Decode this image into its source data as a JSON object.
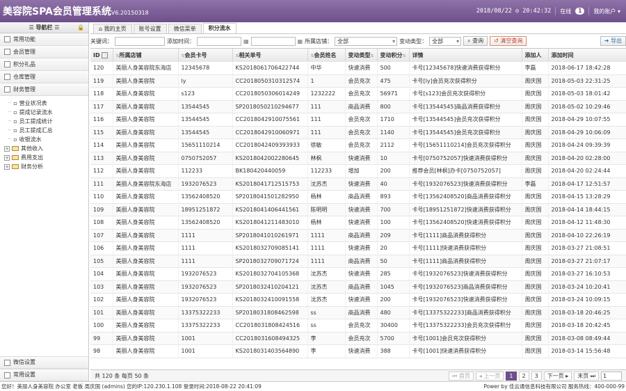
{
  "app": {
    "title": "美容院SPA会员管理系统",
    "version": "V6.20150318"
  },
  "topbar": {
    "datetime": "2018/08/22 ◎ 20:42:32",
    "online_label": "在线",
    "online_count": "1",
    "account_label": "我的账户"
  },
  "sidebar": {
    "header": "导航栏",
    "sections": [
      "常用功能",
      "会员管理",
      "积分礼品",
      "仓库管理",
      "财务管理"
    ],
    "finance_items": [
      "营业状况表",
      "提成记录流水",
      "员工提成统计",
      "员工提成汇总",
      "收银流水"
    ],
    "finance_groups": [
      "其他收入",
      "费用支出",
      "财务分析"
    ],
    "bottom_sections": [
      "微信设置",
      "常用设置"
    ]
  },
  "tabs": [
    "我的主页",
    "账号设置",
    "微信菜单",
    "积分流水"
  ],
  "filter": {
    "keyword_label": "关键词：",
    "time_label": "添加时间：",
    "store_label": "所属店铺：",
    "store_value": "全部",
    "change_type_label": "变动类型：",
    "change_type_value": "全部",
    "search_btn": "查询",
    "clear_btn": "清空查询",
    "export_btn": "导出"
  },
  "table": {
    "columns": [
      "ID",
      "所属店铺",
      "会员卡号",
      "相关单号",
      "会员姓名",
      "变动类型",
      "变动积分",
      "详情",
      "添加人",
      "添加时间"
    ],
    "rows": [
      [
        "120",
        "美丽人身美容院东海店",
        "12345678",
        "KS2018061706422744",
        "中华",
        "快速消费",
        "500",
        "卡号[12345678]快速消费获得积分",
        "李磊",
        "2018-06-17 18:42:28"
      ],
      [
        "119",
        "美丽人身美容院",
        "ly",
        "CC2018050310312574",
        "1",
        "会员充次",
        "475",
        "卡号[ly]会员充次获得积分",
        "周庆国",
        "2018-05-03 22:31:25"
      ],
      [
        "118",
        "美丽人身美容院",
        "s123",
        "CC2018050306014249",
        "1232222",
        "会员充次",
        "56971",
        "卡号[s123]会员充次获得积分",
        "周庆国",
        "2018-05-03 18:01:42"
      ],
      [
        "117",
        "美丽人身美容院",
        "13544545",
        "SP2018050210294677",
        "111",
        "商品消费",
        "800",
        "卡号[13544545]商品消费获得积分",
        "周庆国",
        "2018-05-02 10:29:46"
      ],
      [
        "116",
        "美丽人身美容院",
        "13544545",
        "CC2018042910075561",
        "111",
        "会员充次",
        "1710",
        "卡号[13544545]会员充次获得积分",
        "周庆国",
        "2018-04-29 10:07:55"
      ],
      [
        "115",
        "美丽人身美容院",
        "13544545",
        "CC2018042910060971",
        "111",
        "会员充次",
        "1140",
        "卡号[13544545]会员充次获得积分",
        "周庆国",
        "2018-04-29 10:06:09"
      ],
      [
        "114",
        "美丽人身美容院",
        "15651110214",
        "CC2018042409393933",
        "徐敏",
        "会员充次",
        "2112",
        "卡号[15651110214]会员充次获得积分",
        "周庆国",
        "2018-04-24 09:39:39"
      ],
      [
        "113",
        "美丽人身美容院",
        "0750752057",
        "KS2018042002280645",
        "林枫",
        "快速消费",
        "10",
        "卡号[0750752057]快速消费获得积分",
        "周庆国",
        "2018-04-20 02:28:00"
      ],
      [
        "112",
        "美丽人身美容院",
        "112233",
        "BK180420440059",
        "112233",
        "增加",
        "200",
        "推荐会员[林枫]办卡[0750752057]",
        "周庆国",
        "2018-04-20 02:24:44"
      ],
      [
        "111",
        "美丽人身美容院东海店",
        "1932076523",
        "KS2018041712515753",
        "沈苏杰",
        "快速消费",
        "40",
        "卡号[1932076523]快速消费获得积分",
        "李磊",
        "2018-04-17 12:51:57"
      ],
      [
        "110",
        "美丽人身美容院",
        "13562408520",
        "SP2018041501282950",
        "杨林",
        "商品消费",
        "893",
        "卡号[13562408520]商品消费获得积分",
        "周庆国",
        "2018-04-15 13:28:29"
      ],
      [
        "109",
        "美丽人身美容院",
        "18951251872",
        "KS2018041406441561",
        "陈明明",
        "快速消费",
        "700",
        "卡号[18951251872]快速消费获得积分",
        "周庆国",
        "2018-04-14 18:44:15"
      ],
      [
        "108",
        "美丽人身美容院",
        "13562408520",
        "KS2018041211483010",
        "杨林",
        "快速消费",
        "100",
        "卡号[13562408520]快速消费获得积分",
        "周庆国",
        "2018-04-12 11:48:30"
      ],
      [
        "107",
        "美丽人身美容院",
        "1111",
        "SP2018041010261971",
        "1111",
        "商品消费",
        "209",
        "卡号[1111]商品消费获得积分",
        "周庆国",
        "2018-04-10 22:26:19"
      ],
      [
        "106",
        "美丽人身美容院",
        "1111",
        "KS2018032709085141",
        "1111",
        "快速消费",
        "20",
        "卡号[1111]快速消费获得积分",
        "周庆国",
        "2018-03-27 21:08:51"
      ],
      [
        "105",
        "美丽人身美容院",
        "1111",
        "SP2018032709071724",
        "1111",
        "商品消费",
        "50",
        "卡号[1111]商品消费获得积分",
        "周庆国",
        "2018-03-27 21:07:17"
      ],
      [
        "104",
        "美丽人身美容院",
        "1932076523",
        "KS2018032704105368",
        "沈苏杰",
        "快速消费",
        "285",
        "卡号[1932076523]快速消费获得积分",
        "周庆国",
        "2018-03-27 16:10:53"
      ],
      [
        "103",
        "美丽人身美容院",
        "1932076523",
        "SP2018032410204121",
        "沈苏杰",
        "商品消费",
        "1045",
        "卡号[1932076523]商品消费获得积分",
        "周庆国",
        "2018-03-24 10:20:41"
      ],
      [
        "102",
        "美丽人身美容院",
        "1932076523",
        "KS2018032410091558",
        "沈苏杰",
        "快速消费",
        "200",
        "卡号[1932076523]快速消费获得积分",
        "周庆国",
        "2018-03-24 10:09:15"
      ],
      [
        "101",
        "美丽人身美容院",
        "13375322233",
        "SP2018031808462598",
        "ss",
        "商品消费",
        "480",
        "卡号[13375322233]商品消费获得积分",
        "周庆国",
        "2018-03-18 20:46:25"
      ],
      [
        "100",
        "美丽人身美容院",
        "13375322233",
        "CC2018031808424516",
        "ss",
        "会员充次",
        "30400",
        "卡号[13375322233]会员充次获得积分",
        "周庆国",
        "2018-03-18 20:42:45"
      ],
      [
        "99",
        "美丽人身美容院",
        "1001",
        "CC2018031608494325",
        "李",
        "会员充次",
        "5700",
        "卡号[1001]会员充次获得积分",
        "周庆国",
        "2018-03-08 08:49:44"
      ],
      [
        "98",
        "美丽人身美容院",
        "1001",
        "KS2018031403564890",
        "李",
        "快速消费",
        "388",
        "卡号[1001]快速消费获得积分",
        "周庆国",
        "2018-03-14 15:56:48"
      ]
    ]
  },
  "pager": {
    "summary": "共 120 条 每页 50 条",
    "first": "首页",
    "prev": "上一页",
    "pages": [
      "1",
      "2",
      "3"
    ],
    "next": "下一页",
    "last": "末页",
    "current": "1"
  },
  "status": {
    "left": "您好！美丽人身美容院 办公室 老板 周庆国 (admins) 您的IP:120.230.1.108 登录时间:2018-08-22 20:41:09",
    "right": "Power by 佳云通信息科技有限公司 服务热线：400-000-99"
  }
}
